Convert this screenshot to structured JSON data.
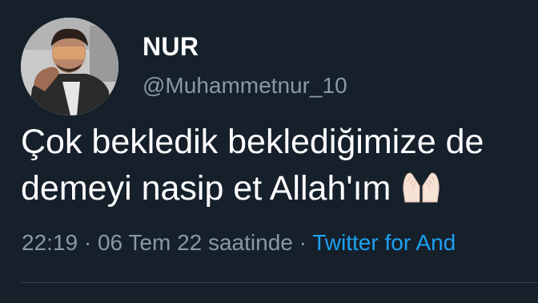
{
  "colors": {
    "background": "#15202b",
    "text_primary": "#ffffff",
    "text_secondary": "#8899a6",
    "link": "#1da1f2",
    "divider": "#38444d"
  },
  "author": {
    "display_name": "NUR",
    "handle": "@Muhammetnur_10",
    "avatar_icon": "profile-photo"
  },
  "tweet": {
    "line1": "Çok bekledik beklediğimize de",
    "line2": "demeyi nasip et  Allah'ım",
    "emoji": "folded-hands-icon"
  },
  "meta": {
    "time": "22:19",
    "separator1": " · ",
    "date": "06 Tem 22 saatinde",
    "separator2": " · ",
    "source": "Twitter for And"
  }
}
